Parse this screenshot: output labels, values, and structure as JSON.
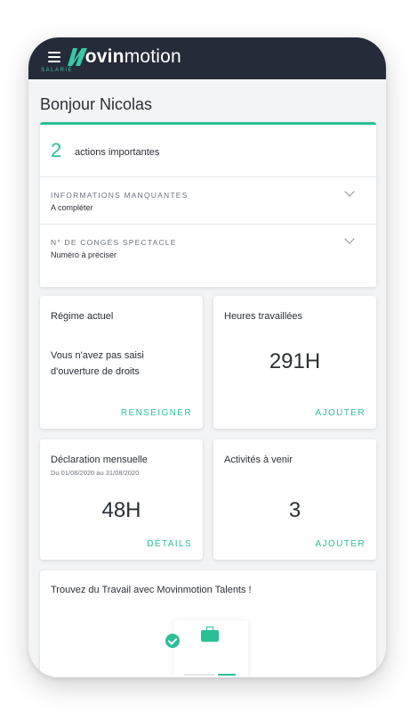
{
  "app": {
    "logo_prefix": "M",
    "logo_bold": "ovin",
    "logo_rest": "motion",
    "logo_sub": "SALARIÉ",
    "accent_color": "#2bbf96",
    "appbar_color": "#262b3a"
  },
  "greeting": "Bonjour Nicolas",
  "actions": {
    "count": "2",
    "label": "actions importantes",
    "items": [
      {
        "title": "INFORMATIONS MANQUANTES",
        "value": "A compléter"
      },
      {
        "title": "N° DE CONGÉS SPECTACLE",
        "value": "Numéro à préciser"
      }
    ]
  },
  "tiles": {
    "regime": {
      "title": "Régime actuel",
      "text": "Vous n'avez pas saisi d'ouverture de droits",
      "action": "RENSEIGNER"
    },
    "heures": {
      "title": "Heures travaillées",
      "value": "291H",
      "action": "AJOUTER"
    },
    "declaration": {
      "title": "Déclaration mensuelle",
      "subtitle": "Du 01/08/2020 au 31/08/2020",
      "value": "48H",
      "action": "DÉTAILS"
    },
    "activites": {
      "title": "Activités à venir",
      "value": "3",
      "action": "AJOUTER"
    }
  },
  "promo": {
    "title": "Trouvez du Travail avec Movinmotion Talents !"
  }
}
